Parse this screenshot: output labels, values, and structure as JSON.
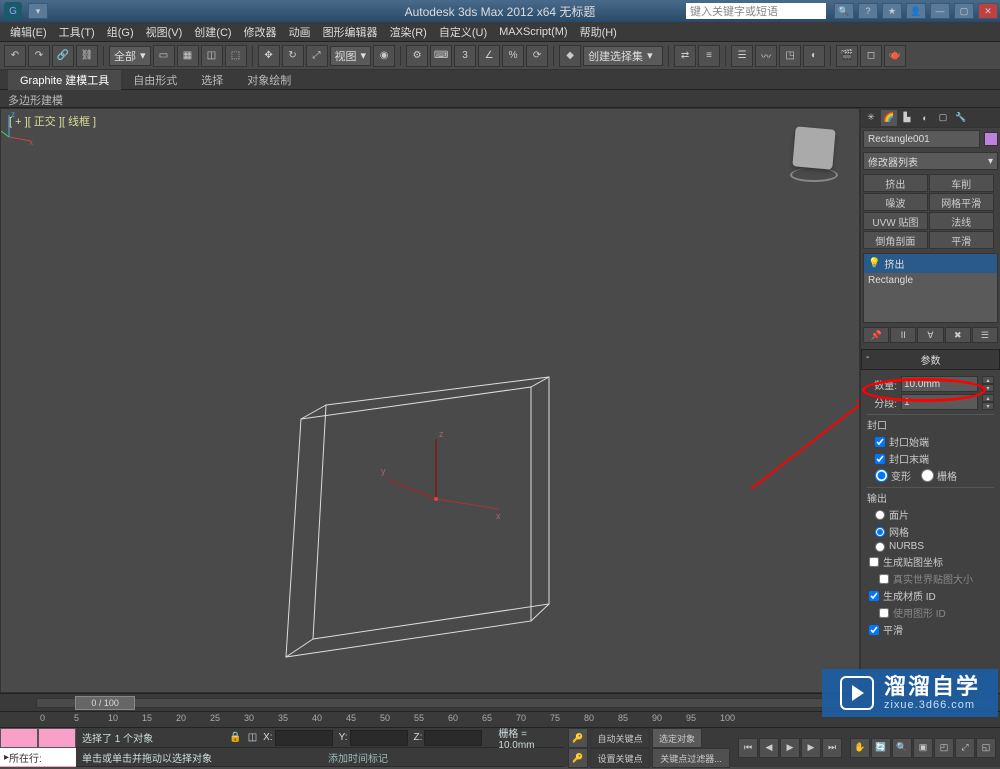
{
  "title": "Autodesk 3ds Max 2012 x64   无标题",
  "search_placeholder": "键入关键字或短语",
  "menu": [
    "编辑(E)",
    "工具(T)",
    "组(G)",
    "视图(V)",
    "创建(C)",
    "修改器",
    "动画",
    "图形编辑器",
    "渲染(R)",
    "自定义(U)",
    "MAXScript(M)",
    "帮助(H)"
  ],
  "toolbar_dropdown1": "全部",
  "toolbar_dropdown2": "视图",
  "toolbar_dropdown3": "创建选择集",
  "ribbon_tabs": [
    "Graphite 建模工具",
    "自由形式",
    "选择",
    "对象绘制"
  ],
  "sub_ribbon": "多边形建模",
  "viewport_label": "[ + ][ 正交 ][ 线框 ]",
  "right_panel": {
    "object_name": "Rectangle001",
    "modifier_list": "修改器列表",
    "mod_buttons": [
      "挤出",
      "车削",
      "噪波",
      "网格平滑",
      "UVW 贴图",
      "法线",
      "倒角剖面",
      "平滑"
    ],
    "stack": [
      "挤出",
      "Rectangle"
    ],
    "rollout_title": "参数",
    "amount_label": "数量:",
    "amount_value": "10.0mm",
    "segments_label": "分段:",
    "segments_value": "1",
    "cap_group": "封口",
    "cap_start": "封口始端",
    "cap_end": "封口末端",
    "cap_morph": "变形",
    "cap_grid": "栅格",
    "output_group": "输出",
    "output_patch": "面片",
    "output_mesh": "网格",
    "output_nurbs": "NURBS",
    "gen_mapping": "生成贴图坐标",
    "real_world": "真实世界贴图大小",
    "gen_matid": "生成材质 ID",
    "use_shapeid": "使用图形 ID",
    "smooth": "平滑"
  },
  "timeline": {
    "frame_display": "0 / 100"
  },
  "ticks": [
    "0",
    "5",
    "10",
    "15",
    "20",
    "25",
    "30",
    "35",
    "40",
    "45",
    "50",
    "55",
    "60",
    "65",
    "70",
    "75",
    "80",
    "85",
    "90",
    "95",
    "100"
  ],
  "status": {
    "goto_label": "所在行:",
    "sel_info": "选择了 1 个对象",
    "hint": "单击或单击并拖动以选择对象",
    "lock": "🔒",
    "coord_x": "X:",
    "coord_y": "Y:",
    "coord_z": "Z:",
    "grid": "栅格 = 10.0mm",
    "autokey": "自动关键点",
    "selected": "选定对象",
    "setkey": "设置关键点",
    "keyfilter": "关键点过滤器...",
    "addtimemark": "添加时间标记"
  },
  "watermark": {
    "big": "溜溜自学",
    "small": "zixue.3d66.com"
  }
}
